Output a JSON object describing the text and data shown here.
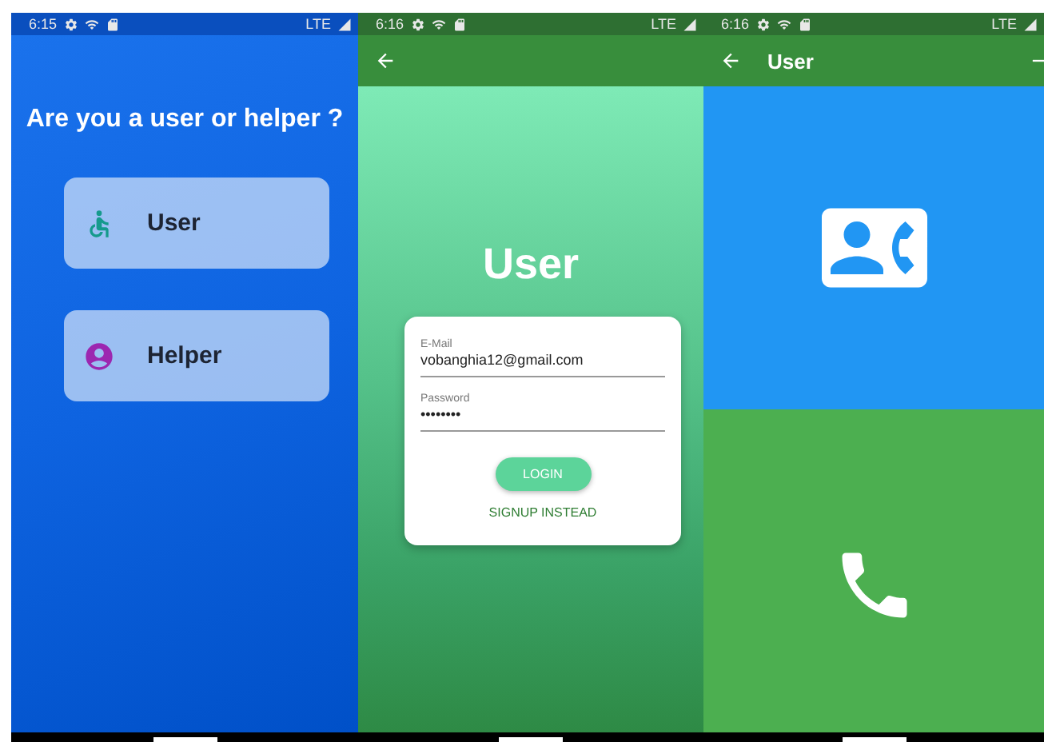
{
  "screens": [
    {
      "kind": "chooser",
      "status_bar": {
        "time": "6:15",
        "network": "LTE"
      },
      "heading": "Are you a user or helper ?",
      "options": [
        {
          "kind": "user",
          "label": "User"
        },
        {
          "kind": "helper",
          "label": "Helper"
        }
      ]
    },
    {
      "kind": "login",
      "status_bar": {
        "time": "6:16",
        "network": "LTE"
      },
      "title": "User",
      "fields": [
        {
          "label": "E-Mail",
          "value": "vobanghia12@gmail.com"
        },
        {
          "label": "Password",
          "value": "••••••••"
        }
      ],
      "login_button": "LOGIN",
      "signup_link": "SIGNUP INSTEAD"
    },
    {
      "kind": "contact",
      "status_bar": {
        "time": "6:16",
        "network": "LTE"
      },
      "app_title": "User",
      "panels": [
        {
          "kind": "contacts"
        },
        {
          "kind": "call"
        }
      ]
    }
  ]
}
